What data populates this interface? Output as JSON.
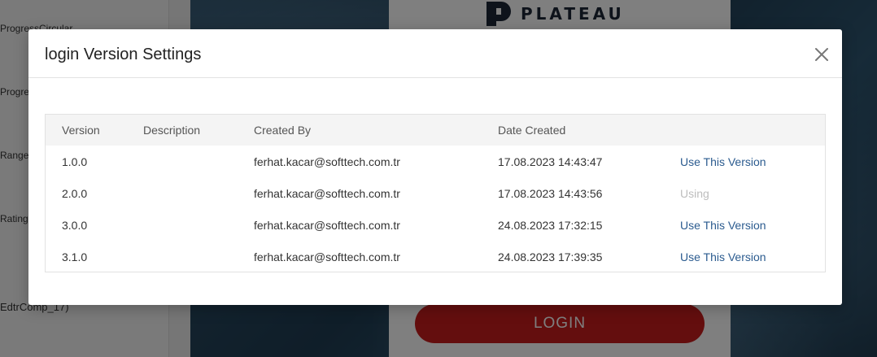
{
  "background": {
    "sidebar_items": [
      "ProgressCircular",
      "Progre",
      "Range",
      "Rating",
      "EdtrComp_17)"
    ],
    "logo_text": "PLATEAU",
    "login_button": "LOGIN"
  },
  "modal": {
    "title": "login Version Settings",
    "close_icon": "close-icon",
    "columns": [
      "Version",
      "Description",
      "Created By",
      "Date Created",
      ""
    ],
    "rows": [
      {
        "version": "1.0.0",
        "description": "",
        "created_by": "ferhat.kacar@softtech.com.tr",
        "date_created": "17.08.2023 14:43:47",
        "action": "Use This Version",
        "action_state": "available"
      },
      {
        "version": "2.0.0",
        "description": "",
        "created_by": "ferhat.kacar@softtech.com.tr",
        "date_created": "17.08.2023 14:43:56",
        "action": "Using",
        "action_state": "current"
      },
      {
        "version": "3.0.0",
        "description": "",
        "created_by": "ferhat.kacar@softtech.com.tr",
        "date_created": "24.08.2023 17:32:15",
        "action": "Use This Version",
        "action_state": "available"
      },
      {
        "version": "3.1.0",
        "description": "",
        "created_by": "ferhat.kacar@softtech.com.tr",
        "date_created": "24.08.2023 17:39:35",
        "action": "Use This Version",
        "action_state": "available"
      }
    ]
  },
  "colors": {
    "link": "#2b5b8f",
    "disabled": "#bdbdbd",
    "login_red": "#c81d1d",
    "overlay": "rgba(0,0,0,0.5)"
  }
}
